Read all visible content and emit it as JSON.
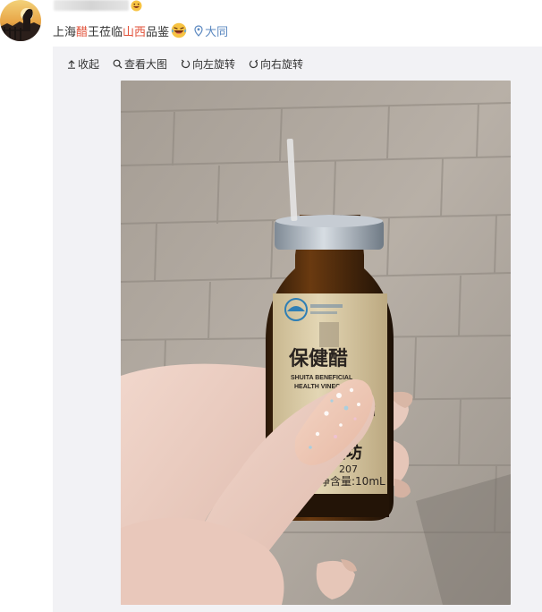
{
  "post": {
    "text_parts": [
      "上海",
      "醋",
      "王莅临",
      "山西",
      "品鉴"
    ],
    "location": "大同"
  },
  "toolbar": {
    "collapse": "收起",
    "view_large": "查看大图",
    "rotate_left": "向左旋转",
    "rotate_right": "向右旋转"
  },
  "photo": {
    "label_main": "保健醋",
    "label_en_1": "SHUITA BENEFICIAL",
    "label_en_2": "HEALTH VINEGAR",
    "label_partial": "酒",
    "label_brand": "醋坊",
    "label_code": "207",
    "label_volume": "净含量:10mL"
  },
  "colors": {
    "accent_red": "#e2523a",
    "location_blue": "#5b88c0",
    "panel_bg": "#f2f2f5"
  }
}
